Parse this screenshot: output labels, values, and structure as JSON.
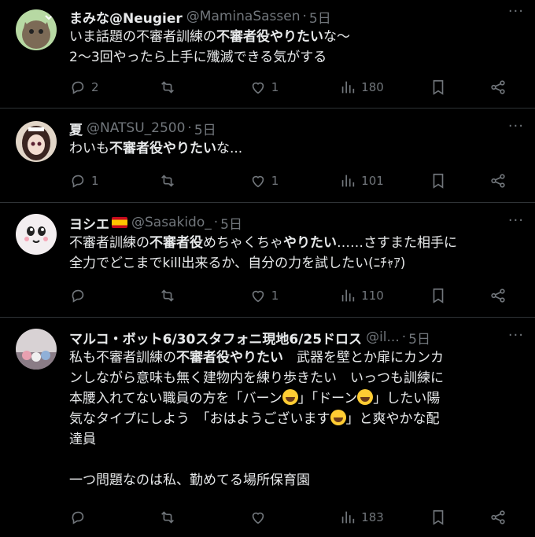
{
  "tweets": [
    {
      "name": "まみな@Neugier",
      "handle": "@MaminaSassen",
      "dot": "·",
      "time": "5日",
      "more": "···",
      "lines": [
        [
          {
            "t": "いま話題の不審者訓練の"
          },
          {
            "t": "不審者役やりたい",
            "b": true
          },
          {
            "t": "な〜"
          }
        ],
        [
          {
            "t": "2〜3回やったら上手に殲滅できる気がする"
          }
        ]
      ],
      "stats": {
        "reply": "2",
        "retweet": "",
        "like": "1",
        "views": "180"
      },
      "avatar_colors": [
        "#b7d9a3",
        "#6a5a48"
      ]
    },
    {
      "name": "夏",
      "handle": "@NATSU_2500",
      "dot": "·",
      "time": "5日",
      "more": "···",
      "lines": [
        [
          {
            "t": "わいも"
          },
          {
            "t": "不審者役やりたい",
            "b": true
          },
          {
            "t": "な..."
          }
        ]
      ],
      "stats": {
        "reply": "1",
        "retweet": "",
        "like": "1",
        "views": "101"
      },
      "avatar_colors": [
        "#d9c7b5",
        "#3a2520"
      ]
    },
    {
      "name": "ヨシエ",
      "handle": "@Sasakido_",
      "dot": "·",
      "time": "5日",
      "more": "···",
      "lines": [
        [
          {
            "t": "不審者訓練の"
          },
          {
            "t": "不審者役",
            "b": true
          },
          {
            "t": "めちゃくちゃ"
          },
          {
            "t": "やりたい",
            "b": true
          },
          {
            "t": "……さすまた相手に"
          }
        ],
        [
          {
            "t": "全力でどこまでkill出来るか、自分の力を試したい(ﾆﾁｬｱ)"
          }
        ]
      ],
      "stats": {
        "reply": "",
        "retweet": "",
        "like": "1",
        "views": "110"
      },
      "avatar_colors": [
        "#f3eef0",
        "#2a2a2a"
      ]
    },
    {
      "name": "マルコ・ボット6/30スタフォニ現地6/25ドロス",
      "handle": "@il...",
      "dot": "·",
      "time": "5日",
      "more": "···",
      "lines": [
        [
          {
            "t": "私も不審者訓練の"
          },
          {
            "t": "不審者役やりたい",
            "b": true
          },
          {
            "t": "　武器を壁とか扉にカンカ"
          }
        ],
        [
          {
            "t": "ンしながら意味も無く建物内を練り歩きたい　いっつも訓練に"
          }
        ],
        [
          {
            "t": "本腰入れてない職員の方を「バーン"
          },
          {
            "e": 1
          },
          {
            "t": "」「ドーン"
          },
          {
            "e": 1
          },
          {
            "t": "」したい陽"
          }
        ],
        [
          {
            "t": "気なタイプにしよう　「おはようございます"
          },
          {
            "e": 1
          },
          {
            "t": "」と爽やかな配"
          }
        ],
        [
          {
            "t": "達員"
          }
        ],
        [
          {
            "t": " "
          }
        ],
        [
          {
            "t": "一つ問題なのは私、勤めてる場所保育園"
          }
        ]
      ],
      "stats": {
        "reply": "",
        "retweet": "",
        "like": "",
        "views": "183"
      },
      "avatar_colors": [
        "#cfc9cc",
        "#7a6a7a"
      ]
    }
  ]
}
